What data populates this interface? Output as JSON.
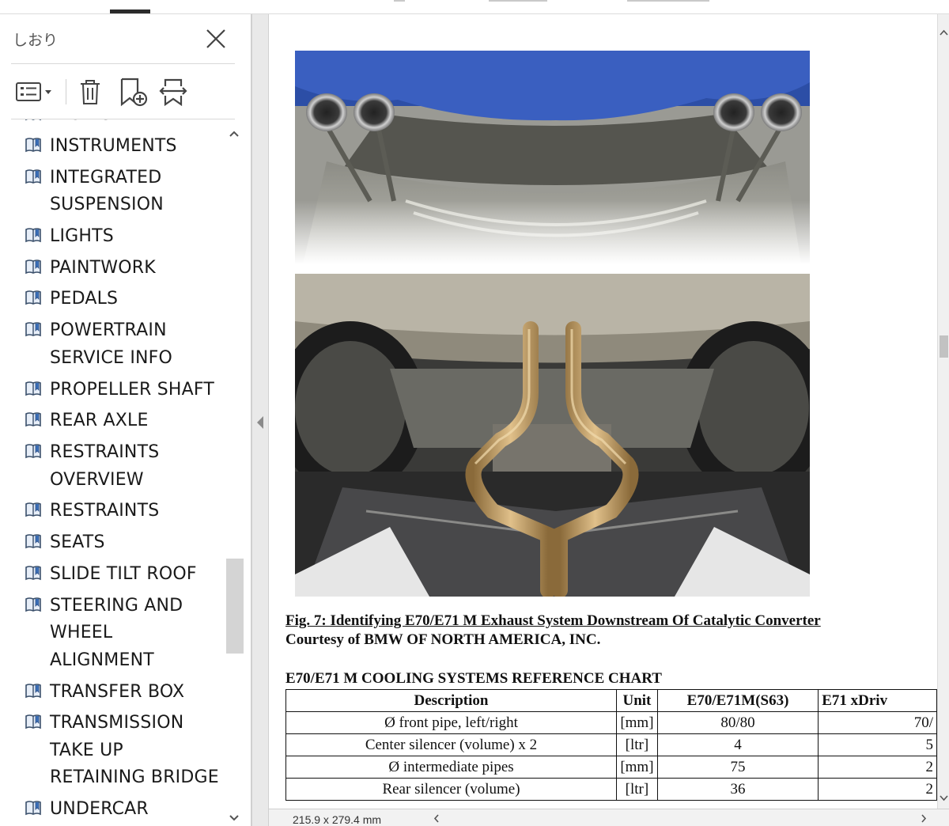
{
  "sidebar": {
    "title": "しおり",
    "items": [
      {
        "label": "FLUIDS"
      },
      {
        "label": "INSTRUMENTS"
      },
      {
        "label": "INTEGRATED\nSUSPENSION"
      },
      {
        "label": "LIGHTS"
      },
      {
        "label": "PAINTWORK"
      },
      {
        "label": "PEDALS"
      },
      {
        "label": "POWERTRAIN\nSERVICE INFO"
      },
      {
        "label": "PROPELLER SHAFT"
      },
      {
        "label": "REAR AXLE"
      },
      {
        "label": "RESTRAINTS\nOVERVIEW"
      },
      {
        "label": "RESTRAINTS"
      },
      {
        "label": "SEATS"
      },
      {
        "label": "SLIDE TILT ROOF"
      },
      {
        "label": "STEERING AND\nWHEEL\nALIGNMENT"
      },
      {
        "label": "TRANSFER BOX"
      },
      {
        "label": "TRANSMISSION\nTAKE UP\nRETAINING BRIDGE"
      },
      {
        "label": "UNDERCAR"
      }
    ]
  },
  "document": {
    "figure_caption": "Fig. 7: Identifying E70/E71 M Exhaust System Downstream Of Catalytic Converter",
    "courtesy": "Courtesy of BMW OF NORTH AMERICA, INC.",
    "chart_title": "E70/E71 M COOLING SYSTEMS REFERENCE CHART",
    "table": {
      "headers": [
        "Description",
        "Unit",
        "E70/E71M(S63)",
        "E71 xDriv"
      ],
      "rows": [
        [
          "Ø front pipe, left/right",
          "[mm]",
          "80/80",
          "70/"
        ],
        [
          "Center silencer (volume) x 2",
          "[ltr]",
          "4",
          "5"
        ],
        [
          "Ø intermediate pipes",
          "[mm]",
          "75",
          "2"
        ],
        [
          "Rear silencer (volume)",
          "[ltr]",
          "36",
          "2"
        ]
      ]
    }
  },
  "status": {
    "page_size": "215.9 x 279.4 mm"
  }
}
